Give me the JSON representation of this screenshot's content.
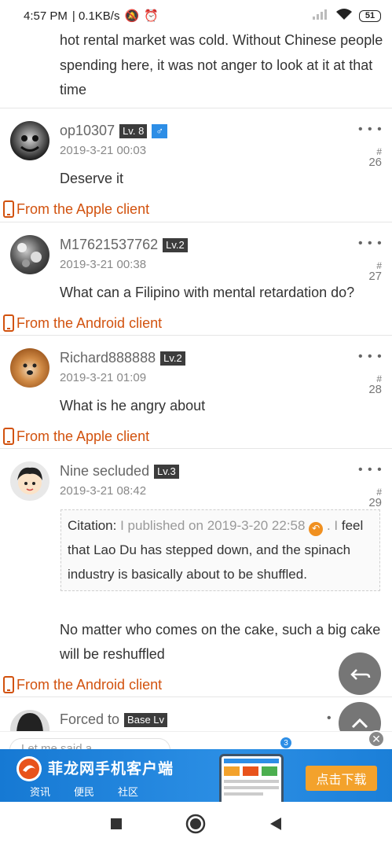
{
  "status_bar": {
    "time": "4:57 PM",
    "network_speed": "| 0.1KB/s",
    "battery": "51"
  },
  "top_text": "hot rental market was cold. Without Chinese people spending here, it was not anger to look at it at that time",
  "posts": [
    {
      "username": "op10307",
      "level": "Lv. 8",
      "gender": "♂",
      "date": "2019-3-21 00:03",
      "floor_hash": "#",
      "floor": "26",
      "content": "Deserve it",
      "client": "From the Apple client"
    },
    {
      "username": "M17621537762",
      "level": "Lv.2",
      "date": "2019-3-21 00:38",
      "floor_hash": "#",
      "floor": "27",
      "content": "What can a Filipino with mental retardation do?",
      "client": "From the Android client"
    },
    {
      "username": "Richard888888",
      "level": "Lv.2",
      "date": "2019-3-21 01:09",
      "floor_hash": "#",
      "floor": "28",
      "content": "What is he angry about",
      "client": "From the Apple client"
    },
    {
      "username": "Nine secluded",
      "level": "Lv.3",
      "date": "2019-3-21 08:42",
      "floor_hash": "#",
      "floor": "29",
      "quote_label": "Citation:",
      "quote_meta": "I published on 2019-3-20 22:58",
      "quote_after_icon": ". I",
      "quote_text": "feel that Lao Du has stepped down, and the spinach industry is basically about to be shuffled.",
      "content": "No matter who comes on the cake, such a big cake will be reshuffled",
      "client": "From the Android client"
    },
    {
      "username": "Forced to",
      "level": "Base Lv",
      "more": "•"
    }
  ],
  "more_dots": "• • •",
  "input": {
    "placeholder": "Let me said a...",
    "badge": "3"
  },
  "ad": {
    "title": "菲龙网手机客户端",
    "subs": [
      "资讯",
      "便民",
      "社区"
    ],
    "download": "点击下载",
    "close": "✕"
  },
  "colors": {
    "accent_client": "#d2520e",
    "level_badge": "#3c3c3c",
    "gender_badge": "#2d8ee6",
    "ad_blue": "#1b7fd8",
    "ad_button": "#f3a22c"
  }
}
